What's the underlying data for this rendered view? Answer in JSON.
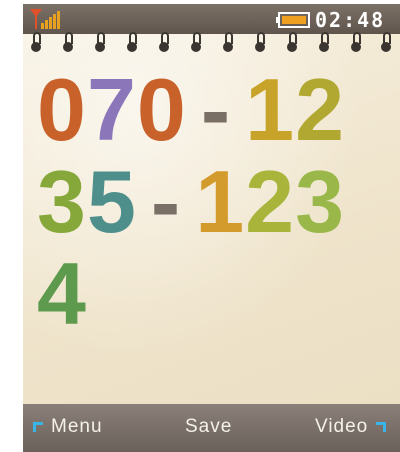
{
  "status_bar": {
    "time": "02:48",
    "signal_icon": "signal-bars-icon",
    "battery_icon": "battery-icon",
    "battery_color": "#f0a020"
  },
  "dialer": {
    "lines": [
      [
        {
          "ch": "0",
          "color": "#c8622a"
        },
        {
          "ch": "7",
          "color": "#8a76b8"
        },
        {
          "ch": "0",
          "color": "#c8622a"
        },
        {
          "ch": "-",
          "color": "#7a6f65"
        },
        {
          "ch": "1",
          "color": "#c8a32a"
        },
        {
          "ch": "2",
          "color": "#b0a830"
        }
      ],
      [
        {
          "ch": "3",
          "color": "#86a83a"
        },
        {
          "ch": "5",
          "color": "#4e8f8c"
        },
        {
          "ch": "-",
          "color": "#7a6f65"
        },
        {
          "ch": "1",
          "color": "#d39b2c"
        },
        {
          "ch": "2",
          "color": "#a8b43a"
        },
        {
          "ch": "3",
          "color": "#9ab84a"
        }
      ],
      [
        {
          "ch": "4",
          "color": "#5d9a4d"
        }
      ]
    ]
  },
  "softkeys": {
    "left": "Menu",
    "center": "Save",
    "right": "Video",
    "arrow_color": "#3ab5e8"
  }
}
